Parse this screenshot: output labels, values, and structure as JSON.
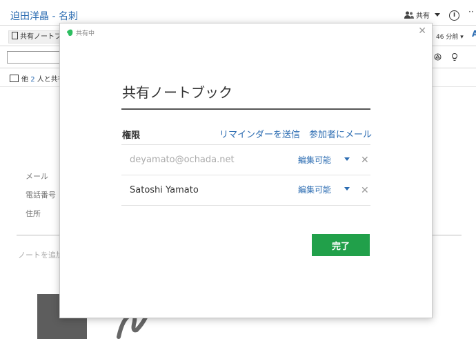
{
  "note": {
    "title": "迫田洋晶 - 名刺",
    "share_label": "共有",
    "time_ago": "46 分前",
    "notebook_tag": "共有ノートブック",
    "shared_prefix": "他",
    "shared_count": "2",
    "shared_suffix": "人と共有",
    "fields": [
      "メール",
      "電話番号",
      "住所"
    ],
    "add_note_placeholder": "ノートを追加"
  },
  "modal": {
    "header_label": "共有中",
    "title": "共有ノートブック",
    "permission_label": "権限",
    "send_reminder": "リマインダーを送信",
    "email_participants": "参加者にメール",
    "members": [
      {
        "email": "deyamato@ochada.net",
        "permission": "編集可能",
        "pending": true
      },
      {
        "email": "Satoshi Yamato",
        "permission": "編集可能",
        "pending": false
      }
    ],
    "done_label": "完了"
  },
  "colors": {
    "link": "#2a6bb1",
    "done_button": "#21a04a",
    "evernote_logo": "#2dbe60"
  }
}
